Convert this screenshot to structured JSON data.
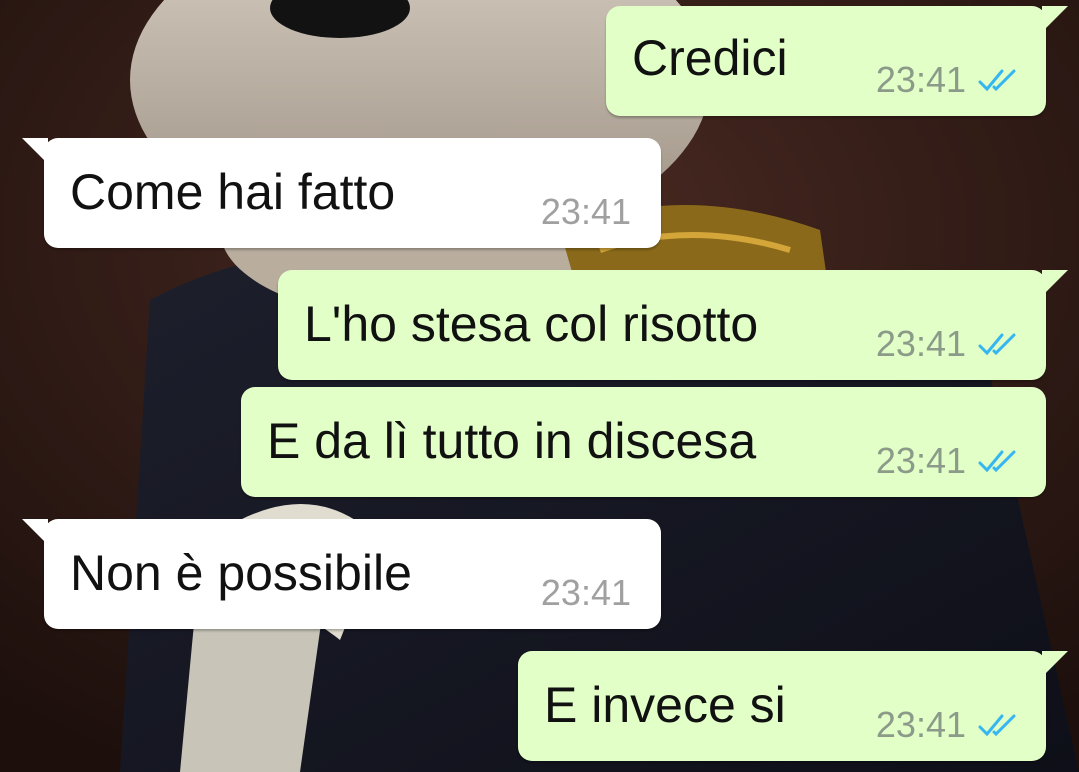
{
  "messages": [
    {
      "direction": "out",
      "text": "Credici",
      "time": "23:41",
      "status_icon": "double-check-read-icon"
    },
    {
      "direction": "in",
      "text": "Come hai fatto",
      "time": "23:41"
    },
    {
      "direction": "out",
      "text": "L'ho stesa col risotto",
      "time": "23:41",
      "status_icon": "double-check-read-icon"
    },
    {
      "direction": "out",
      "text": "E da lì tutto in discesa",
      "time": "23:41",
      "status_icon": "double-check-read-icon"
    },
    {
      "direction": "in",
      "text": "Non è possibile",
      "time": "23:41"
    },
    {
      "direction": "out",
      "text": "E invece si",
      "time": "23:41",
      "status_icon": "double-check-read-icon"
    }
  ],
  "colors": {
    "outgoing_bubble": "#e1ffc7",
    "incoming_bubble": "#ffffff",
    "read_ticks": "#34b7f1"
  }
}
